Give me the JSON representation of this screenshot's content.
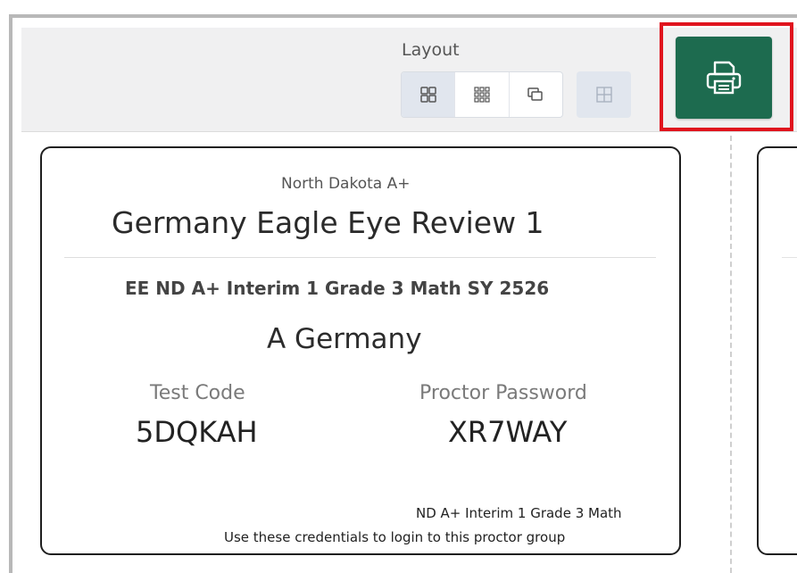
{
  "toolbar": {
    "layout_label": "Layout",
    "layout_options": [
      {
        "icon": "grid-2x2-icon",
        "active": true
      },
      {
        "icon": "grid-3x3-icon",
        "active": false
      },
      {
        "icon": "stacked-cards-icon",
        "active": false
      }
    ],
    "extra_option_icon": "table-grid-icon",
    "print_icon": "printer-icon",
    "print_button_color": "#1d6b4f",
    "highlight_color": "#e0141e"
  },
  "card": {
    "state": "North Dakota A+",
    "group_name": "Germany Eagle Eye Review 1",
    "test_name": "EE ND A+ Interim 1 Grade 3 Math SY 2526",
    "student_name": "A Germany",
    "test_code_label": "Test Code",
    "test_code": "5DQKAH",
    "proctor_password_label": "Proctor Password",
    "proctor_password": "XR7WAY",
    "footer_test": "ND A+ Interim 1 Grade 3 Math",
    "footer_note": "Use these credentials to login to this proctor group"
  }
}
